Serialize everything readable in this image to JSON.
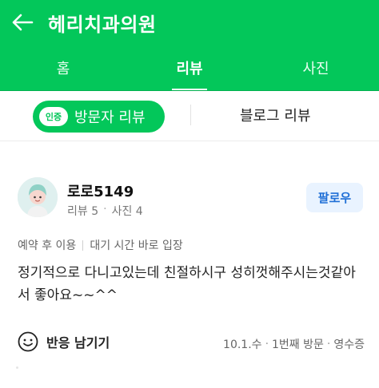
{
  "header": {
    "title": "헤리치과의원"
  },
  "tabs": [
    {
      "label": "홈",
      "active": false
    },
    {
      "label": "리뷰",
      "active": true
    },
    {
      "label": "사진",
      "active": false
    }
  ],
  "subtabs": {
    "verified_badge": "인증",
    "visitor_review": "방문자 리뷰",
    "blog_review": "블로그 리뷰"
  },
  "review": {
    "nickname": "로로5149",
    "review_count": "리뷰 5",
    "photo_count": "사진 4",
    "follow_label": "팔로우",
    "tags": [
      "예약 후 이용",
      "대기 시간 바로 입장"
    ],
    "text": "정기적으로 다니고있는데 친절하시구 성히껏해주시는것같아서 좋아요~~^^",
    "reaction_label": "반응 남기기",
    "visit_date": "10.1.수",
    "visit_count": "1번째 방문",
    "receipt": "영수증"
  },
  "colors": {
    "brand_green": "#03c75a",
    "follow_blue": "#1f6fd6",
    "follow_bg": "#e9f3ff"
  },
  "icons": {
    "back": "arrow-left-icon",
    "reaction": "smile-icon",
    "avatar": "avatar-illustration"
  }
}
